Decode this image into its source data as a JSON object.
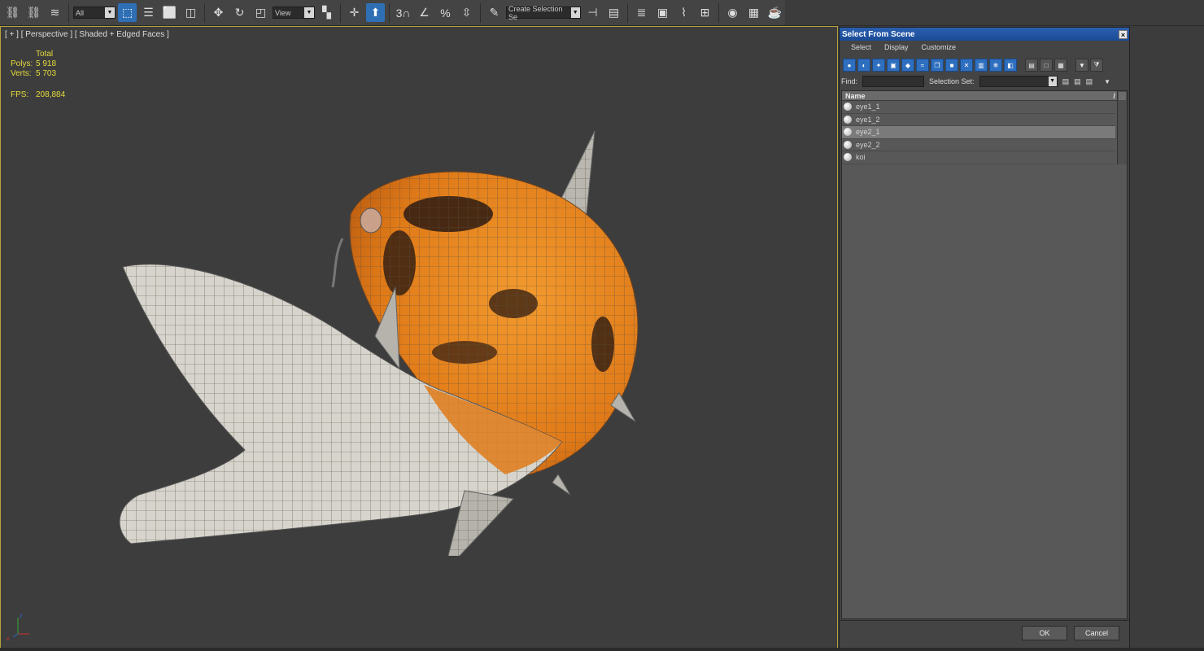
{
  "toolbar": {
    "selection_filter": "All",
    "reference_coord": "View",
    "named_selection_placeholder": "Create Selection Se",
    "snaps_3d_label": "3",
    "percent_label": "%"
  },
  "viewport": {
    "label": "[ + ] [ Perspective ] [ Shaded + Edged Faces ]",
    "stats": {
      "total_label": "Total",
      "polys_label": "Polys:",
      "polys_value": "5 918",
      "verts_label": "Verts:",
      "verts_value": "5 703",
      "fps_label": "FPS:",
      "fps_value": "208,884"
    },
    "axis": {
      "x": "x",
      "y": "y",
      "z": "z"
    }
  },
  "dialog": {
    "title": "Select From Scene",
    "close": "×",
    "menu": [
      "Select",
      "Display",
      "Customize"
    ],
    "find_label": "Find:",
    "selection_set_label": "Selection Set:",
    "list_header": "Name",
    "sort_indicator": "/",
    "items": [
      {
        "name": "eye1_1",
        "selected": false
      },
      {
        "name": "eye1_2",
        "selected": false
      },
      {
        "name": "eye2_1",
        "selected": true
      },
      {
        "name": "eye2_2",
        "selected": false
      },
      {
        "name": "koi",
        "selected": false
      }
    ],
    "ok_label": "OK",
    "cancel_label": "Cancel"
  },
  "colors": {
    "accent": "#2f6fb5",
    "stats_text": "#e6dc3c",
    "viewport_border": "#b8a23c"
  }
}
